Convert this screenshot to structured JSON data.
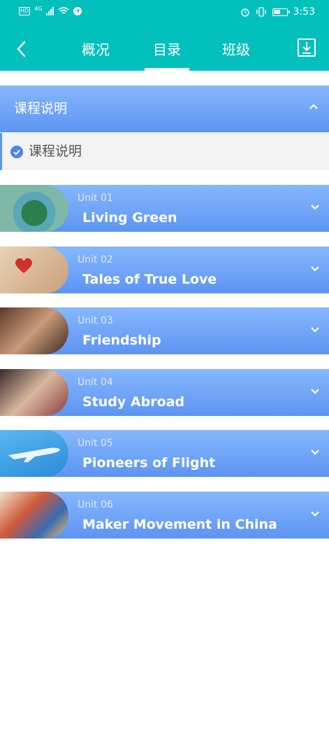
{
  "status": {
    "time": "3:53",
    "network": "4G",
    "hd": "HD"
  },
  "header": {
    "tabs": [
      {
        "label": "概况"
      },
      {
        "label": "目录"
      },
      {
        "label": "班级"
      }
    ],
    "active_tab": "目录"
  },
  "section": {
    "title": "课程说明",
    "sub_item": "课程说明"
  },
  "units": [
    {
      "num": "Unit 01",
      "title": "Living Green"
    },
    {
      "num": "Unit 02",
      "title": "Tales of True Love"
    },
    {
      "num": "Unit 03",
      "title": "Friendship"
    },
    {
      "num": "Unit 04",
      "title": "Study Abroad"
    },
    {
      "num": "Unit 05",
      "title": "Pioneers of Flight"
    },
    {
      "num": "Unit 06",
      "title": "Maker Movement in China"
    }
  ],
  "colors": {
    "header_bg": "#02c0bb",
    "card_top": "#86b8fd",
    "card_bottom": "#5d94f2",
    "check": "#4f86ea"
  }
}
